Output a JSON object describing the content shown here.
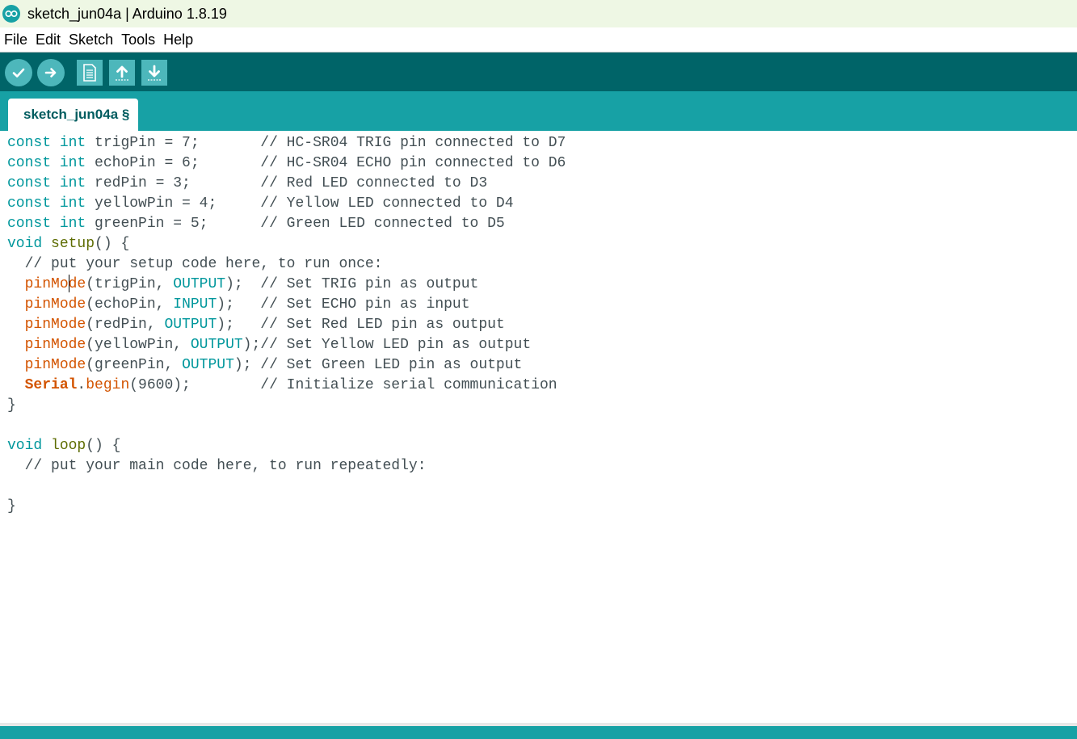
{
  "window": {
    "title": "sketch_jun04a | Arduino 1.8.19"
  },
  "menu": {
    "items": [
      "File",
      "Edit",
      "Sketch",
      "Tools",
      "Help"
    ]
  },
  "toolbar": {
    "buttons": [
      {
        "name": "verify",
        "icon": "check-icon"
      },
      {
        "name": "upload",
        "icon": "arrow-right-icon"
      },
      {
        "name": "new",
        "icon": "document-icon"
      },
      {
        "name": "open",
        "icon": "arrow-up-icon"
      },
      {
        "name": "save",
        "icon": "arrow-down-icon"
      }
    ]
  },
  "tabs": [
    {
      "label": "sketch_jun04a §"
    }
  ],
  "editor": {
    "lines": [
      "const int trigPin = 7;       // HC-SR04 TRIG pin connected to D7",
      "const int echoPin = 6;       // HC-SR04 ECHO pin connected to D6",
      "const int redPin = 3;        // Red LED connected to D3",
      "const int yellowPin = 4;     // Yellow LED connected to D4",
      "const int greenPin = 5;      // Green LED connected to D5",
      "void setup() {",
      "  // put your setup code here, to run once:",
      "  pinMode(trigPin, OUTPUT);  // Set TRIG pin as output",
      "  pinMode(echoPin, INPUT);   // Set ECHO pin as input",
      "  pinMode(redPin, OUTPUT);   // Set Red LED pin as output",
      "  pinMode(yellowPin, OUTPUT);// Set Yellow LED pin as output",
      "  pinMode(greenPin, OUTPUT); // Set Green LED pin as output",
      "  Serial.begin(9600);        // Initialize serial communication",
      "}",
      "",
      "void loop() {",
      "  // put your main code here, to run repeatedly:",
      "",
      "}"
    ]
  },
  "colors": {
    "toolbar_bg": "#006468",
    "tabbar_bg": "#17a1a5",
    "keyword": "#00979c",
    "function": "#d35400",
    "function_def": "#5e6d03",
    "text": "#434f54"
  }
}
